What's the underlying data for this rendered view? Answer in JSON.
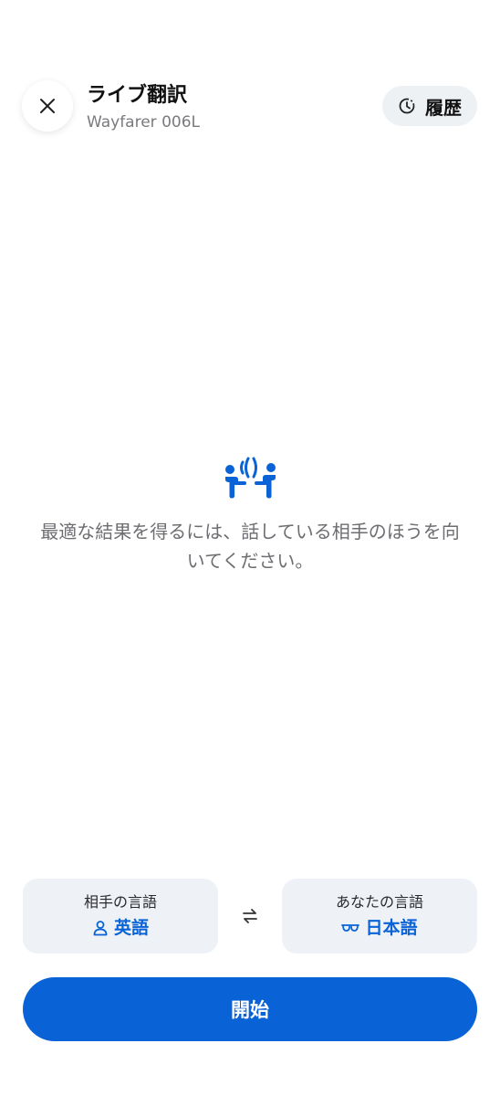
{
  "header": {
    "title": "ライブ翻訳",
    "subtitle": "Wayfarer 006L",
    "close_icon": "close-icon",
    "history": {
      "label": "履歴",
      "icon": "history-clock-icon"
    }
  },
  "main": {
    "illustration_icon": "conversation-people-icon",
    "hint_text": "最適な結果を得るには、話している相手のほうを向いてください。"
  },
  "languages": {
    "other": {
      "caption": "相手の言語",
      "value": "英語",
      "icon": "person-icon"
    },
    "swap_icon": "swap-arrows-icon",
    "yours": {
      "caption": "あなたの言語",
      "value": "日本語",
      "icon": "glasses-icon"
    }
  },
  "actions": {
    "start_label": "開始"
  },
  "colors": {
    "accent": "#0a63d6",
    "card_bg": "#eef2f6",
    "pill_bg": "#eef1f4",
    "hint_text": "#6d6d72"
  }
}
